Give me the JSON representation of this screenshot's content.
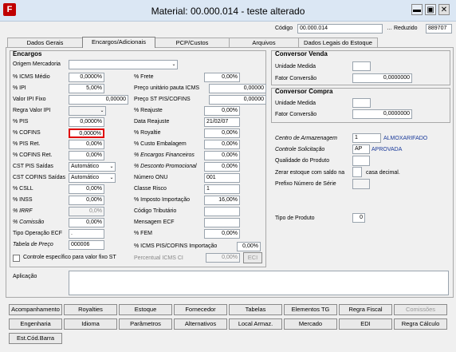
{
  "window": {
    "title": "Material: 00.000.014 - teste alterado",
    "app_icon": "F",
    "minimize": "▬",
    "maximize": "▣",
    "close": "✕"
  },
  "header": {
    "codigo_label": "Código",
    "codigo_value": "00.000.014",
    "reduzido_label": "Reduzido",
    "reduzido_value": "889707"
  },
  "tabs": [
    "Dados Gerais",
    "Encargos/Adicionais",
    "PCP/Custos",
    "Arquivos",
    "Dados Legais do Estoque"
  ],
  "encargos": {
    "title": "Encargos",
    "origem_label": "Origem Mercadoria",
    "origem_value": "",
    "left": [
      {
        "label": "% ICMS Médio",
        "value": "0,0000%"
      },
      {
        "label": "% IPI",
        "value": "5,00%"
      },
      {
        "label": "Valor IPI Fixo",
        "value": "0,00000"
      },
      {
        "label": "Regra Valor IPI",
        "value": ""
      },
      {
        "label": "% PIS",
        "value": "0,0000%"
      },
      {
        "label": "% COFINS",
        "value": "0,0000%"
      },
      {
        "label": "% PIS Ret.",
        "value": "0,00%"
      },
      {
        "label": "% COFINS Ret.",
        "value": "0,00%"
      },
      {
        "label": "CST PIS Saídas",
        "value": "Automático"
      },
      {
        "label": "CST COFINS Saídas",
        "value": "Automático"
      },
      {
        "label": "% CSLL",
        "value": "0,00%"
      },
      {
        "label": "% INSS",
        "value": "0,00%"
      },
      {
        "label": "% IRRF",
        "value": "0,0%"
      },
      {
        "label": "% Comissão",
        "value": "0,00%"
      },
      {
        "label": "Tipo Operação ECF",
        "value": "."
      },
      {
        "label": "Tabela de Preço",
        "value": "000006"
      }
    ],
    "right": [
      {
        "label": "% Frete",
        "value": "0,00%"
      },
      {
        "label": "Preço unitário pauta ICMS",
        "value": "0,00000"
      },
      {
        "label": "Preço ST PIS/COFINS",
        "value": "0,00000"
      },
      {
        "label": "% Reajuste",
        "value": "0,00%"
      },
      {
        "label": "Data Reajuste",
        "value": "21/02/07"
      },
      {
        "label": "% Royaltie",
        "value": "0,00%"
      },
      {
        "label": "% Custo Embalagem",
        "value": "0,00%"
      },
      {
        "label": "% Encargos Financeiros",
        "value": "0,00%"
      },
      {
        "label": "% Desconto Promocional",
        "value": "0,00%"
      },
      {
        "label": "Número ONU",
        "value": "001"
      },
      {
        "label": "Classe Risco",
        "value": "1"
      },
      {
        "label": "% Imposto Importação",
        "value": "16,00%"
      },
      {
        "label": "Código Tributário",
        "value": ""
      },
      {
        "label": "Mensagem ECF",
        "value": ""
      },
      {
        "label": "% FEM",
        "value": "0,00%"
      }
    ],
    "icms_pis_label": "% ICMS PIS/COFINS Importação",
    "icms_pis_value": "0,00%",
    "controle_label": "Controle específico para valor fixo ST",
    "perc_icms_ci_label": "Percentual ICMS CI",
    "perc_icms_ci_value": "0,00%",
    "eci_button": "ECI"
  },
  "conversor_venda": {
    "title": "Conversor Venda",
    "unidade_label": "Unidade Medida",
    "unidade_value": "",
    "fator_label": "Fator Conversão",
    "fator_value": "0,0000000"
  },
  "conversor_compra": {
    "title": "Conversor Compra",
    "unidade_label": "Unidade Medida",
    "unidade_value": "",
    "fator_label": "Fator Conversão",
    "fator_value": "0,0000000"
  },
  "extra": {
    "centro_label": "Centro de Armazenagem",
    "centro_value": "1",
    "centro_desc": "ALMOXARIFADO",
    "controle_label": "Controle Solicitação",
    "controle_value": "AP",
    "controle_desc": "APROVADA",
    "qualidade_label": "Qualidade do Produto",
    "zerar_label": "Zerar estoque com saldo na",
    "zerar_suffix": "casa decimal.",
    "prefixo_label": "Prefixo Número de Série",
    "tipo_label": "Tipo de Produto",
    "tipo_value": "0"
  },
  "aplicacao_label": "Aplicação",
  "buttons_row1": [
    "Acompanhamento",
    "Royalties",
    "Estoque",
    "Fornecedor",
    "Tabelas",
    "Elementos TG",
    "Regra Fiscal",
    "Comissões"
  ],
  "buttons_row2": [
    "Engenharia",
    "Idioma",
    "Parâmetros",
    "Alternativos",
    "Local Armaz.",
    "Mercado",
    "EDI",
    "Regra Cálculo"
  ],
  "buttons_row3": [
    "Est.Cód.Barra"
  ],
  "colors": {
    "titlebar": "#dbe7f4",
    "highlight_border": "#e00000",
    "blue_text": "#1a3a9a"
  }
}
